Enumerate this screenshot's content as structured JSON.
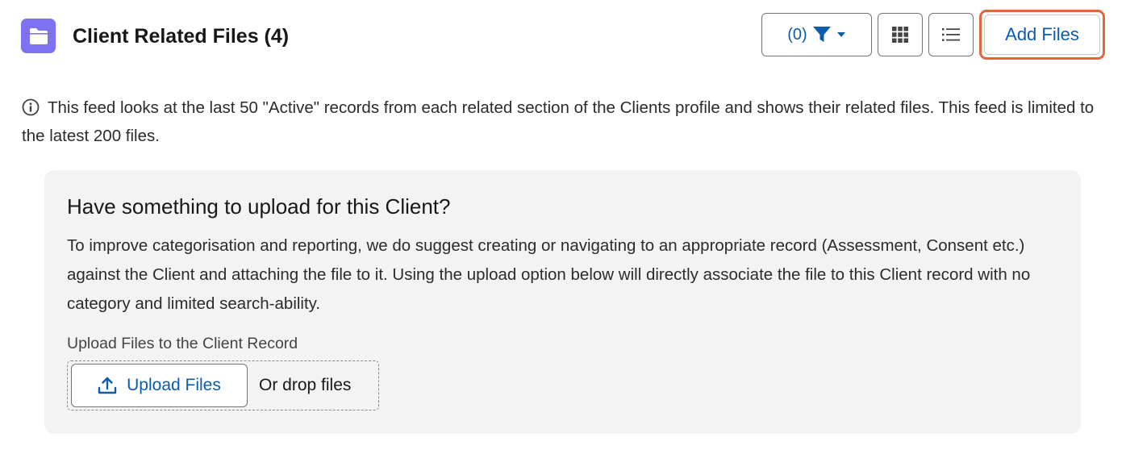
{
  "header": {
    "title": "Client Related Files (4)",
    "filter_label": "(0)",
    "add_files_label": "Add Files",
    "icons": {
      "header": "folder-icon",
      "filter": "filter-icon",
      "filter_menu": "chevron-down-icon",
      "grid_view": "grid-view-icon",
      "list_view": "list-view-icon"
    }
  },
  "info": {
    "icon": "info-icon",
    "text": "This feed looks at the last 50 \"Active\" records from each related section of the Clients profile and shows their related files. This feed is limited to the latest 200 files."
  },
  "upload_panel": {
    "heading": "Have something to upload for this Client?",
    "body": "To improve categorisation and reporting, we do suggest creating or navigating to an appropriate record (Assessment, Consent etc.) against the Client and attaching the file to it. Using the upload option below will directly associate the file to this Client record with no category and limited search-ability.",
    "field_label": "Upload Files to the Client Record",
    "upload_button_label": "Upload Files",
    "upload_icon": "upload-icon",
    "drop_text": "Or drop files"
  },
  "colors": {
    "accent": "#0b5cab",
    "folder_badge": "#7f72f0",
    "highlight_border": "#e0673d",
    "panel_bg": "#f3f3f4"
  }
}
